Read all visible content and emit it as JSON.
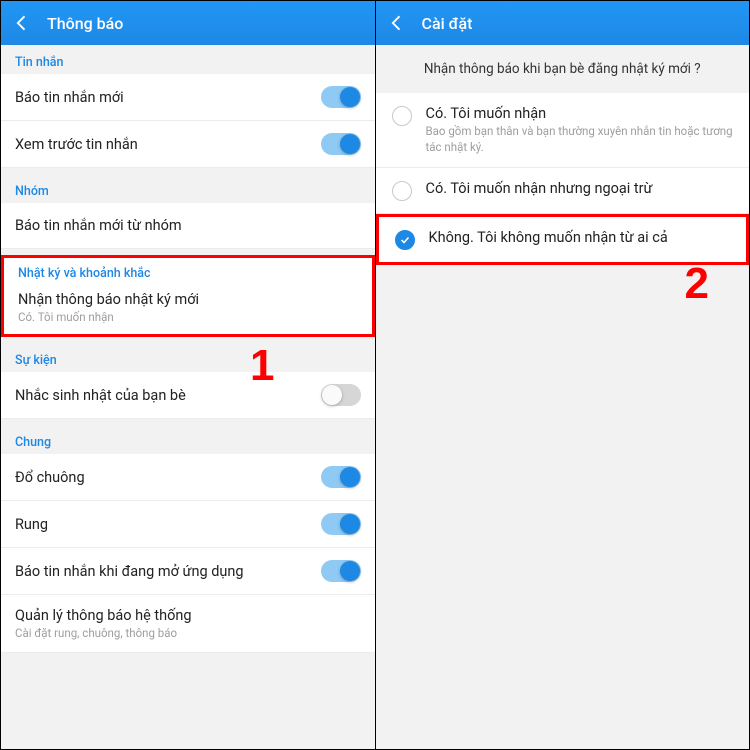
{
  "left": {
    "title": "Thông báo",
    "sections": {
      "tinnhan": {
        "label": "Tin nhắn",
        "row1": "Báo tin nhắn mới",
        "row2": "Xem trước tin nhắn"
      },
      "nhom": {
        "label": "Nhóm",
        "row1": "Báo tin nhắn mới từ nhóm"
      },
      "nhatky": {
        "label": "Nhật ký và khoảnh khắc",
        "row1": "Nhận thông báo nhật ký mới",
        "row1sub": "Có. Tôi muốn nhận"
      },
      "sukien": {
        "label": "Sự kiện",
        "row1": "Nhắc sinh nhật của bạn bè"
      },
      "chung": {
        "label": "Chung",
        "row1": "Đổ chuông",
        "row2": "Rung",
        "row3": "Báo tin nhắn khi đang mở ứng dụng",
        "row4": "Quản lý thông báo hệ thống",
        "row4sub": "Cài đặt rung, chuông, thông báo"
      }
    },
    "annotation": "1"
  },
  "right": {
    "title": "Cài đặt",
    "question": "Nhận thông báo khi bạn bè đăng nhật ký mới ?",
    "opt1": {
      "label": "Có. Tôi muốn nhận",
      "sub": "Bao gồm bạn thân và bạn thường xuyên nhắn tin hoặc tương tác nhật ký."
    },
    "opt2": {
      "label": "Có. Tôi muốn nhận nhưng ngoại trừ"
    },
    "opt3": {
      "label": "Không. Tôi không muốn nhận từ ai cả"
    },
    "annotation": "2"
  }
}
